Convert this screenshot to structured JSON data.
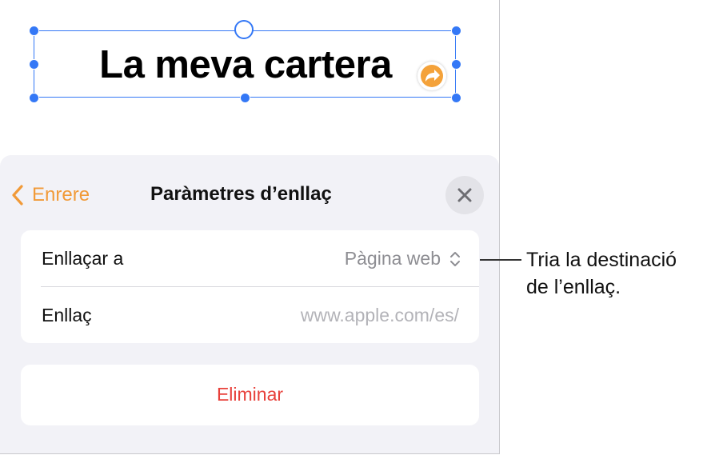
{
  "document": {
    "title": "La meva cartera"
  },
  "link_settings": {
    "back_label": "Enrere",
    "title": "Paràmetres d’enllaç",
    "rows": [
      {
        "label": "Enllaçar a",
        "value": "Pàgina web"
      },
      {
        "label": "Enllaç",
        "value": "www.apple.com/es/"
      }
    ],
    "delete_label": "Eliminar"
  },
  "callout": {
    "line1": "Tria la destinació",
    "line2": "de l’enllaç."
  },
  "colors": {
    "accent": "#f19a38",
    "selection": "#3478f6",
    "destructive": "#e8403a",
    "panel_bg": "#f2f2f7"
  },
  "icons": [
    "chevron-left-icon",
    "close-icon",
    "up-down-chevron-icon",
    "link-arrow-icon"
  ]
}
